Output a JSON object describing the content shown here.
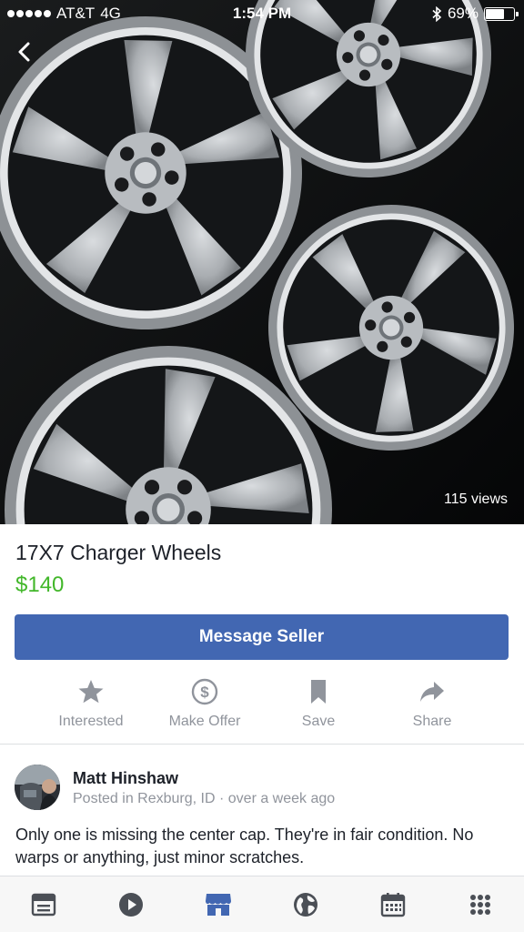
{
  "status_bar": {
    "carrier": "AT&T",
    "network": "4G",
    "time": "1:54 PM",
    "battery_percent": "69%",
    "battery_level": 0.69,
    "icons": [
      "signal-dots-icon",
      "bluetooth-icon",
      "battery-icon"
    ]
  },
  "photo": {
    "views": "115 views"
  },
  "listing": {
    "title": "17X7 Charger Wheels",
    "price": "$140",
    "price_color": "#42b72a"
  },
  "primary_action": {
    "label": "Message Seller",
    "color": "#4267b2"
  },
  "actions": [
    {
      "label": "Interested",
      "icon": "star-icon"
    },
    {
      "label": "Make Offer",
      "icon": "dollar-circle-icon"
    },
    {
      "label": "Save",
      "icon": "bookmark-icon"
    },
    {
      "label": "Share",
      "icon": "share-arrow-icon"
    }
  ],
  "seller": {
    "name": "Matt Hinshaw",
    "posted_prefix": "Posted in Rexburg, ID",
    "separator": "·",
    "posted_time": "over a week ago"
  },
  "description": "Only one is missing the center cap. They're in fair condition. No warps or anything, just minor scratches.",
  "tab_bar": {
    "tabs": [
      {
        "icon": "news-feed-icon",
        "active": false
      },
      {
        "icon": "video-play-icon",
        "active": false
      },
      {
        "icon": "marketplace-icon",
        "active": true
      },
      {
        "icon": "globe-icon",
        "active": false
      },
      {
        "icon": "calendar-icon",
        "active": false
      },
      {
        "icon": "more-grid-icon",
        "active": false
      }
    ],
    "active_color": "#4267b2",
    "inactive_color": "#4b4f56"
  }
}
